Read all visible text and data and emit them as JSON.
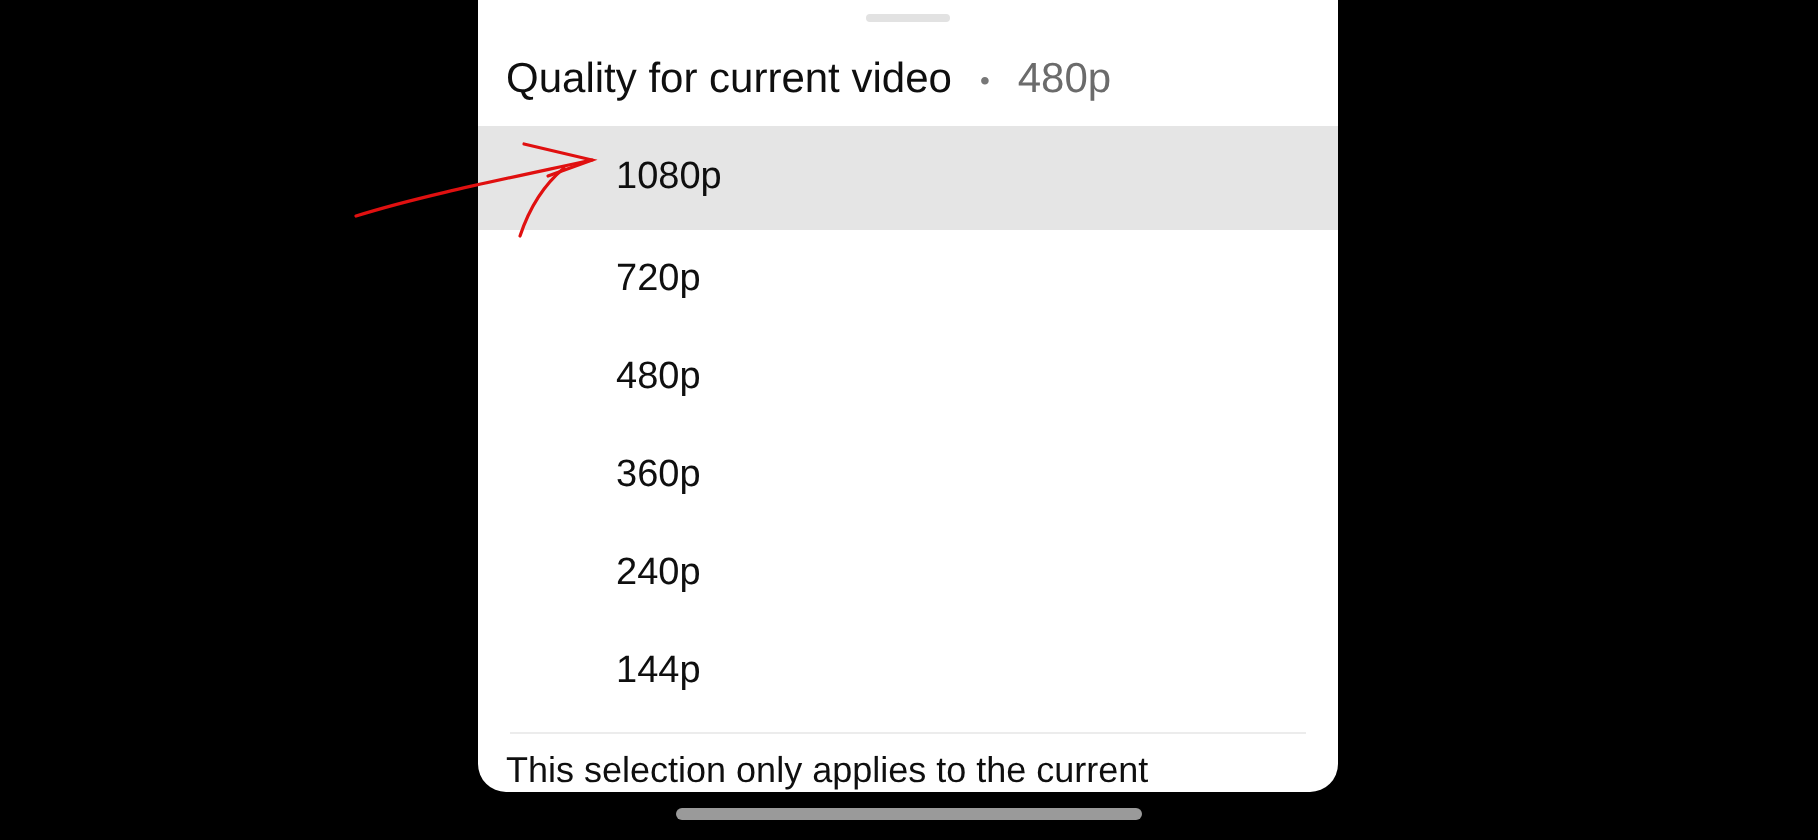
{
  "sheet": {
    "title": "Quality for current video",
    "separator": "•",
    "current": "480p",
    "options": [
      {
        "label": "1080p",
        "highlighted": true
      },
      {
        "label": "720p",
        "highlighted": false
      },
      {
        "label": "480p",
        "highlighted": false
      },
      {
        "label": "360p",
        "highlighted": false
      },
      {
        "label": "240p",
        "highlighted": false
      },
      {
        "label": "144p",
        "highlighted": false
      }
    ],
    "note": "This selection only applies to the current"
  }
}
